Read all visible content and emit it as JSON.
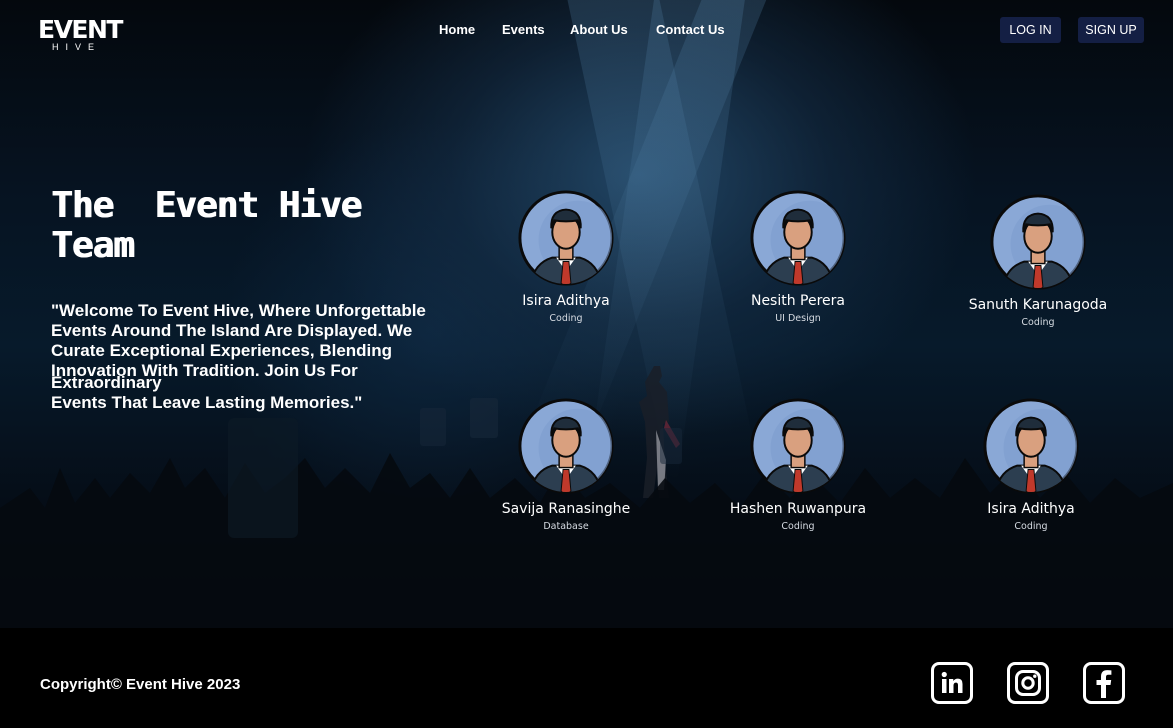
{
  "brand": {
    "name": "EVENT",
    "sub": "HIVE"
  },
  "nav": {
    "links": [
      "Home",
      "Events",
      "About Us",
      "Contact Us"
    ],
    "login": "LOG IN",
    "signup": "SIGN UP"
  },
  "hero": {
    "title_line1": "The  Event Hive",
    "title_line2": "Team",
    "welcome_line1": "\"Welcome To Event Hive, Where Unforgettable Events Around The Island Are Displayed. We Curate Exceptional Experiences, Blending Innovation With Tradition. Join Us For",
    "welcome_line2": "Extraordinary\nEvents That Leave Lasting Memories.\""
  },
  "team": [
    {
      "name": "Isira Adithya",
      "role": "Coding"
    },
    {
      "name": "Nesith Perera",
      "role": "UI Design"
    },
    {
      "name": "Sanuth Karunagoda",
      "role": "Coding"
    },
    {
      "name": "Savija Ranasinghe",
      "role": "Database"
    },
    {
      "name": "Hashen Ruwanpura",
      "role": "Coding"
    },
    {
      "name": "Isira Adithya",
      "role": "Coding"
    }
  ],
  "footer": {
    "copyright": "Copyright© Event Hive 2023",
    "social": [
      "linkedin-icon",
      "instagram-icon",
      "facebook-icon"
    ]
  },
  "colors": {
    "button_bg": "#141f44",
    "avatar_bg": "#8aa8d6",
    "suit": "#2c3e50",
    "tie": "#c0392b",
    "skin": "#d9a07f",
    "footer_bg": "#000000"
  }
}
